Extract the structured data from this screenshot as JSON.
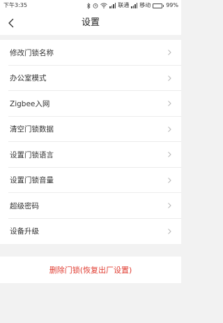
{
  "status_bar": {
    "time": "下午3:35",
    "carrier1": "联通",
    "carrier2": "移动",
    "battery": "99%",
    "battery_level": 0.99
  },
  "header": {
    "title": "设置",
    "back_icon": "chevron-left-icon"
  },
  "settings": {
    "items": [
      {
        "label": "修改门锁名称"
      },
      {
        "label": "办公室模式"
      },
      {
        "label": "Zigbee入网"
      },
      {
        "label": "清空门锁数据"
      },
      {
        "label": "设置门锁语言"
      },
      {
        "label": "设置门锁音量"
      },
      {
        "label": "超级密码"
      },
      {
        "label": "设备升级"
      }
    ]
  },
  "delete": {
    "label": "删除门锁(恢复出厂设置)",
    "color": "#e03c31"
  },
  "colors": {
    "background": "#f2f2f2",
    "surface": "#ffffff",
    "danger": "#e03c31"
  }
}
